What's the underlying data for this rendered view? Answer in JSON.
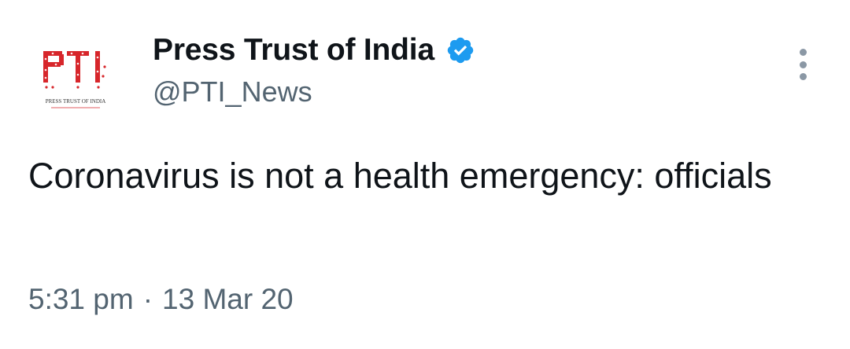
{
  "author": {
    "display_name": "Press Trust of India",
    "handle": "@PTI_News",
    "verified": true,
    "avatar": {
      "icon": "pti-logo",
      "logo_text": "PTI",
      "logo_caption": "PRESS TRUST OF INDIA"
    }
  },
  "tweet": {
    "text": "Coronavirus is not a health emergency: officials",
    "time": "5:31 pm",
    "separator": "·",
    "date": "13 Mar 20"
  },
  "actions": {
    "more_icon": "more-vertical-icon"
  },
  "colors": {
    "text_primary": "#0f1419",
    "text_secondary": "#536471",
    "verified_blue": "#1d9bf0",
    "logo_red": "#d7262b"
  }
}
